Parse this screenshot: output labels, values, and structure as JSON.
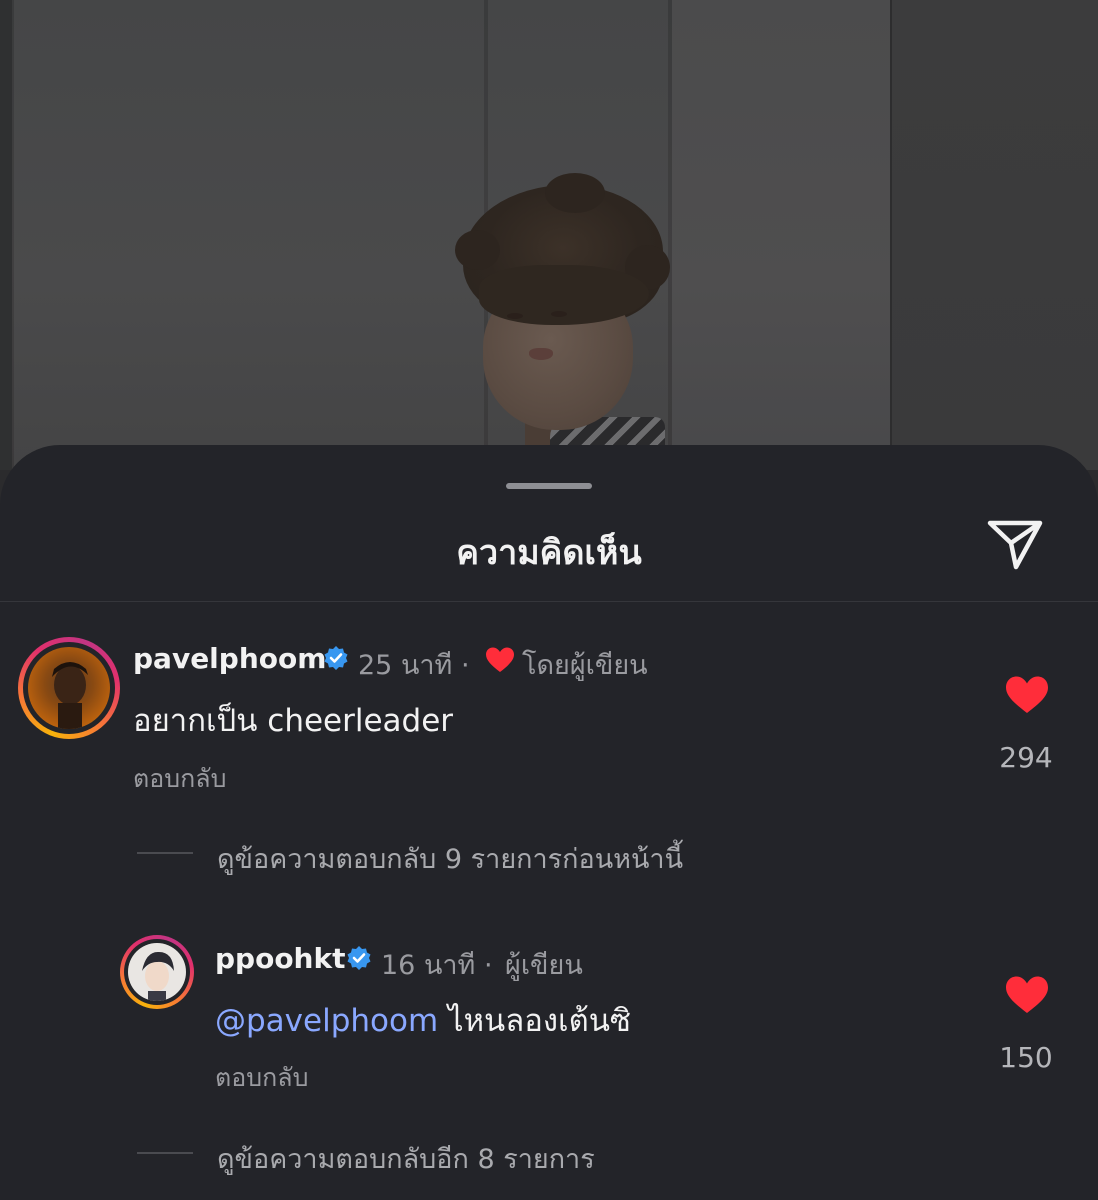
{
  "sheet": {
    "title": "ความคิดเห็น",
    "share_icon": "paper-plane-icon"
  },
  "comments": [
    {
      "username": "pavelphoom",
      "verified": true,
      "time": "25 นาที ·",
      "liked_by_author_label": "โดยผู้เขียน",
      "text": "อยากเป็น cheerleader",
      "reply_label": "ตอบกลับ",
      "like_count": "294",
      "heart_color": "#ff2d3a"
    },
    {
      "username": "ppoohkt",
      "verified": true,
      "time": "16 นาที ·",
      "author_label": "ผู้เขียน",
      "mention": "@pavelphoom",
      "text": "ไหนลองเต้นซิ",
      "reply_label": "ตอบกลับ",
      "like_count": "150",
      "heart_color": "#ff2d3a"
    }
  ],
  "view_previous_replies": "ดูข้อความตอบกลับ 9 รายการก่อนหน้านี้",
  "view_more_replies": "ดูข้อความตอบกลับอีก 8 รายการ",
  "colors": {
    "sheet_bg": "#232429",
    "mention": "#8aa8ff",
    "verified": "#3897f0"
  }
}
